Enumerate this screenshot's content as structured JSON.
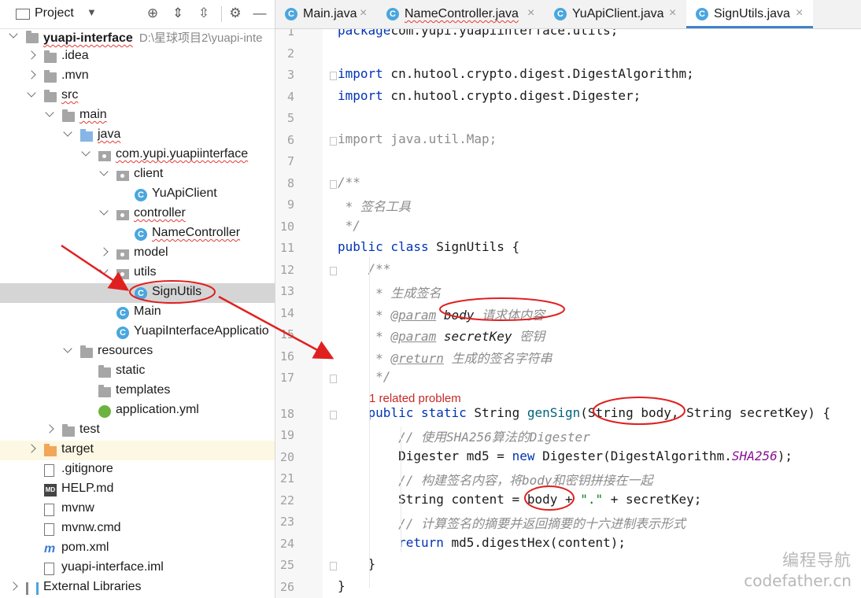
{
  "project_panel": {
    "title": "Project",
    "tree": [
      {
        "label": "yuapi-interface",
        "path": "D:\\星球项目2\\yuapi-inte",
        "icon": "module-folder-icon",
        "depth": 0,
        "state": "expanded",
        "bold": true,
        "squiggle": true
      },
      {
        "label": ".idea",
        "icon": "folder-icon",
        "depth": 1,
        "state": "collapsed"
      },
      {
        "label": ".mvn",
        "icon": "folder-icon",
        "depth": 1,
        "state": "collapsed"
      },
      {
        "label": "src",
        "icon": "folder-icon",
        "depth": 1,
        "state": "expanded",
        "squiggle": true
      },
      {
        "label": "main",
        "icon": "folder-icon",
        "depth": 2,
        "state": "expanded",
        "squiggle": true
      },
      {
        "label": "java",
        "icon": "source-folder-icon",
        "depth": 3,
        "state": "expanded",
        "squiggle": true
      },
      {
        "label": "com.yupi.yuapiinterface",
        "icon": "package-icon",
        "depth": 4,
        "state": "expanded",
        "squiggle": true
      },
      {
        "label": "client",
        "icon": "package-icon",
        "depth": 5,
        "state": "expanded"
      },
      {
        "label": "YuApiClient",
        "icon": "class-icon",
        "depth": 6,
        "state": "leaf"
      },
      {
        "label": "controller",
        "icon": "package-icon",
        "depth": 5,
        "state": "expanded",
        "squiggle": true
      },
      {
        "label": "NameController",
        "icon": "class-icon",
        "depth": 6,
        "state": "leaf",
        "squiggle": true
      },
      {
        "label": "model",
        "icon": "package-icon",
        "depth": 5,
        "state": "collapsed"
      },
      {
        "label": "utils",
        "icon": "package-icon",
        "depth": 5,
        "state": "expanded"
      },
      {
        "label": "SignUtils",
        "icon": "class-icon",
        "depth": 6,
        "state": "leaf",
        "selected": true
      },
      {
        "label": "Main",
        "icon": "class-icon",
        "depth": 5,
        "state": "leaf"
      },
      {
        "label": "YuapiInterfaceApplicatio",
        "icon": "spring-class-icon",
        "depth": 5,
        "state": "leaf"
      },
      {
        "label": "resources",
        "icon": "resources-folder-icon",
        "depth": 3,
        "state": "expanded"
      },
      {
        "label": "static",
        "icon": "folder-icon",
        "depth": 4,
        "state": "leaf"
      },
      {
        "label": "templates",
        "icon": "folder-icon",
        "depth": 4,
        "state": "leaf"
      },
      {
        "label": "application.yml",
        "icon": "yml-file-icon",
        "depth": 4,
        "state": "leaf"
      },
      {
        "label": "test",
        "icon": "folder-icon",
        "depth": 2,
        "state": "collapsed"
      },
      {
        "label": "target",
        "icon": "target-folder-icon",
        "depth": 1,
        "state": "collapsed",
        "highlight": true
      },
      {
        "label": ".gitignore",
        "icon": "gitignore-file-icon",
        "depth": 1,
        "state": "leaf"
      },
      {
        "label": "HELP.md",
        "icon": "md-file-icon",
        "depth": 1,
        "state": "leaf"
      },
      {
        "label": "mvnw",
        "icon": "file-icon",
        "depth": 1,
        "state": "leaf"
      },
      {
        "label": "mvnw.cmd",
        "icon": "file-icon",
        "depth": 1,
        "state": "leaf"
      },
      {
        "label": "pom.xml",
        "icon": "maven-icon",
        "depth": 1,
        "state": "leaf"
      },
      {
        "label": "yuapi-interface.iml",
        "icon": "iml-file-icon",
        "depth": 1,
        "state": "leaf"
      },
      {
        "label": "External Libraries",
        "icon": "libraries-icon",
        "depth": 0,
        "state": "collapsed"
      }
    ]
  },
  "tabs": [
    {
      "label": "Main.java",
      "active": false,
      "squiggle": false
    },
    {
      "label": "NameController.java",
      "active": false,
      "squiggle": true
    },
    {
      "label": "YuApiClient.java",
      "active": false,
      "squiggle": false
    },
    {
      "label": "SignUtils.java",
      "active": true,
      "squiggle": false
    }
  ],
  "editor": {
    "lines": [
      {
        "n": "1",
        "tokens": [
          [
            "kw",
            "package"
          ],
          [
            "",
            "com.yupi.yuapiinterface.utils;"
          ]
        ]
      },
      {
        "n": "2",
        "tokens": []
      },
      {
        "n": "3",
        "tokens": [
          [
            "kw",
            "import"
          ],
          [
            "",
            " cn.hutool.crypto.digest.DigestAlgorithm;"
          ]
        ],
        "fold": true
      },
      {
        "n": "4",
        "tokens": [
          [
            "kw",
            "import"
          ],
          [
            "",
            " cn.hutool.crypto.digest.Digester;"
          ]
        ]
      },
      {
        "n": "5",
        "tokens": []
      },
      {
        "n": "6",
        "tokens": [
          [
            "gray",
            "import java.util.Map;"
          ]
        ],
        "fold": true
      },
      {
        "n": "7",
        "tokens": []
      },
      {
        "n": "8",
        "tokens": [
          [
            "cm",
            "/**"
          ]
        ],
        "fold": true
      },
      {
        "n": "9",
        "tokens": [
          [
            "cm",
            " * 签名工具"
          ]
        ]
      },
      {
        "n": "10",
        "tokens": [
          [
            "cm",
            " */"
          ]
        ]
      },
      {
        "n": "11",
        "tokens": [
          [
            "kw",
            "public class"
          ],
          [
            "",
            " SignUtils {"
          ]
        ]
      },
      {
        "n": "12",
        "tokens": [
          [
            "cm",
            "    /**"
          ]
        ],
        "fold": true
      },
      {
        "n": "13",
        "tokens": [
          [
            "cm",
            "     * 生成签名"
          ]
        ]
      },
      {
        "n": "14",
        "tokens": [
          [
            "cm",
            "     * "
          ],
          [
            "tag",
            "@param"
          ],
          [
            "pn",
            " body"
          ],
          [
            "cm",
            " 请求体内容"
          ]
        ]
      },
      {
        "n": "15",
        "tokens": [
          [
            "cm",
            "     * "
          ],
          [
            "tag",
            "@param"
          ],
          [
            "pn",
            " secretKey"
          ],
          [
            "cm",
            " 密钥"
          ]
        ]
      },
      {
        "n": "16",
        "tokens": [
          [
            "cm",
            "     * "
          ],
          [
            "tag",
            "@return"
          ],
          [
            "cm",
            " 生成的签名字符串"
          ]
        ]
      },
      {
        "n": "17",
        "tokens": [
          [
            "cm",
            "     */"
          ]
        ],
        "fold": true
      },
      {
        "n": "18",
        "tokens": [
          [
            "kw",
            "    public static"
          ],
          [
            "",
            " String "
          ],
          [
            "fn",
            "genSign"
          ],
          [
            "",
            "(String body, String secretKey) {"
          ]
        ],
        "fold": true
      },
      {
        "n": "19",
        "tokens": [
          [
            "cm",
            "        // 使用SHA256算法的Digester"
          ]
        ]
      },
      {
        "n": "20",
        "tokens": [
          [
            "",
            "        Digester md5 = "
          ],
          [
            "kw",
            "new"
          ],
          [
            "",
            " Digester(DigestAlgorithm."
          ],
          [
            "sf",
            "SHA256"
          ],
          [
            "",
            ");"
          ]
        ]
      },
      {
        "n": "21",
        "tokens": [
          [
            "cm",
            "        // 构建签名内容，将body和密钥拼接在一起"
          ]
        ]
      },
      {
        "n": "22",
        "tokens": [
          [
            "",
            "        String content = body + "
          ],
          [
            "st",
            "\".\""
          ],
          [
            "",
            " + secretKey;"
          ]
        ]
      },
      {
        "n": "23",
        "tokens": [
          [
            "cm",
            "        // 计算签名的摘要并返回摘要的十六进制表示形式"
          ]
        ]
      },
      {
        "n": "24",
        "tokens": [
          [
            "kw",
            "        return"
          ],
          [
            "",
            " md5.digestHex(content);"
          ]
        ]
      },
      {
        "n": "25",
        "tokens": [
          [
            "",
            "    }"
          ]
        ],
        "fold": true
      },
      {
        "n": "26",
        "tokens": [
          [
            "",
            "}"
          ]
        ]
      }
    ],
    "inlay_hint": "1 related problem"
  },
  "watermark": {
    "line1": "编程导航",
    "line2": "codefather.cn"
  },
  "colors": {
    "accent": "#4083c9",
    "annotation_red": "#e02020",
    "keyword": "#0033b3",
    "comment": "#8c8c8c"
  }
}
